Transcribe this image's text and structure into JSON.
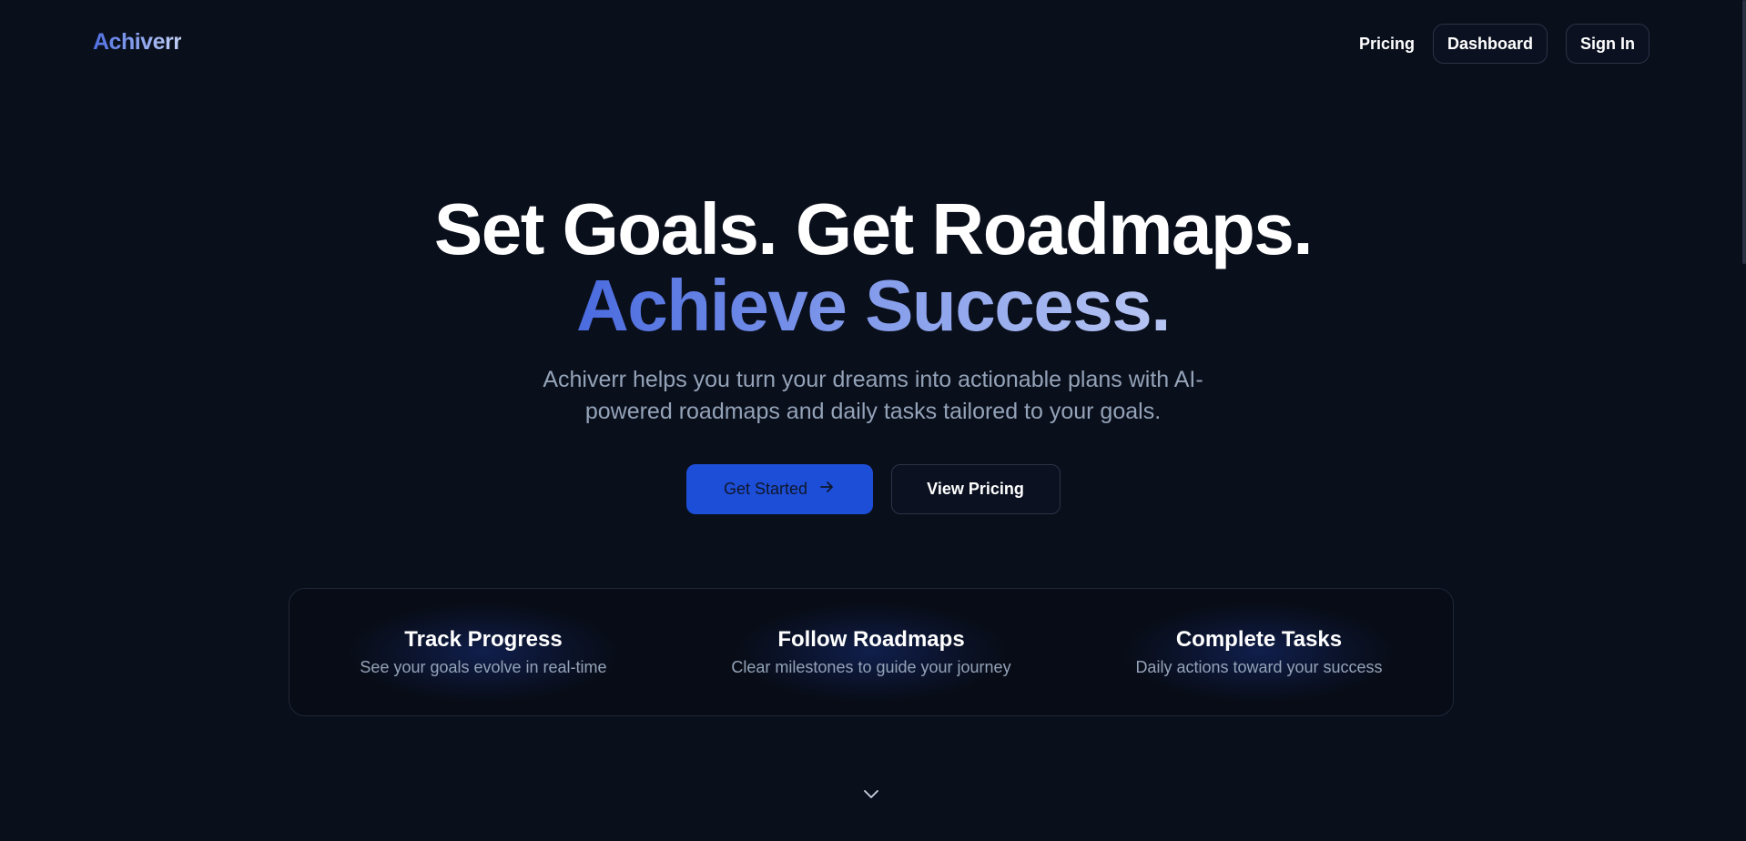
{
  "nav": {
    "logo": "Achiverr",
    "links": {
      "pricing": "Pricing",
      "dashboard": "Dashboard",
      "sign_in": "Sign In"
    }
  },
  "hero": {
    "headline_line1": "Set Goals. Get Roadmaps.",
    "headline_line2": "Achieve Success.",
    "subtitle": "Achiverr helps you turn your dreams into actionable plans with AI-powered roadmaps and daily tasks tailored to your goals.",
    "primary_cta": "Get Started",
    "secondary_cta": "View Pricing"
  },
  "features": [
    {
      "title": "Track Progress",
      "desc": "See your goals evolve in real-time"
    },
    {
      "title": "Follow Roadmaps",
      "desc": "Clear milestones to guide your journey"
    },
    {
      "title": "Complete Tasks",
      "desc": "Daily actions toward your success"
    }
  ],
  "colors": {
    "background": "#0a0f1c",
    "accent": "#1d4ed8",
    "muted_text": "#94a3b8"
  },
  "icons": {
    "cta_arrow": "arrow-right-icon",
    "scroll": "chevron-down-icon"
  }
}
